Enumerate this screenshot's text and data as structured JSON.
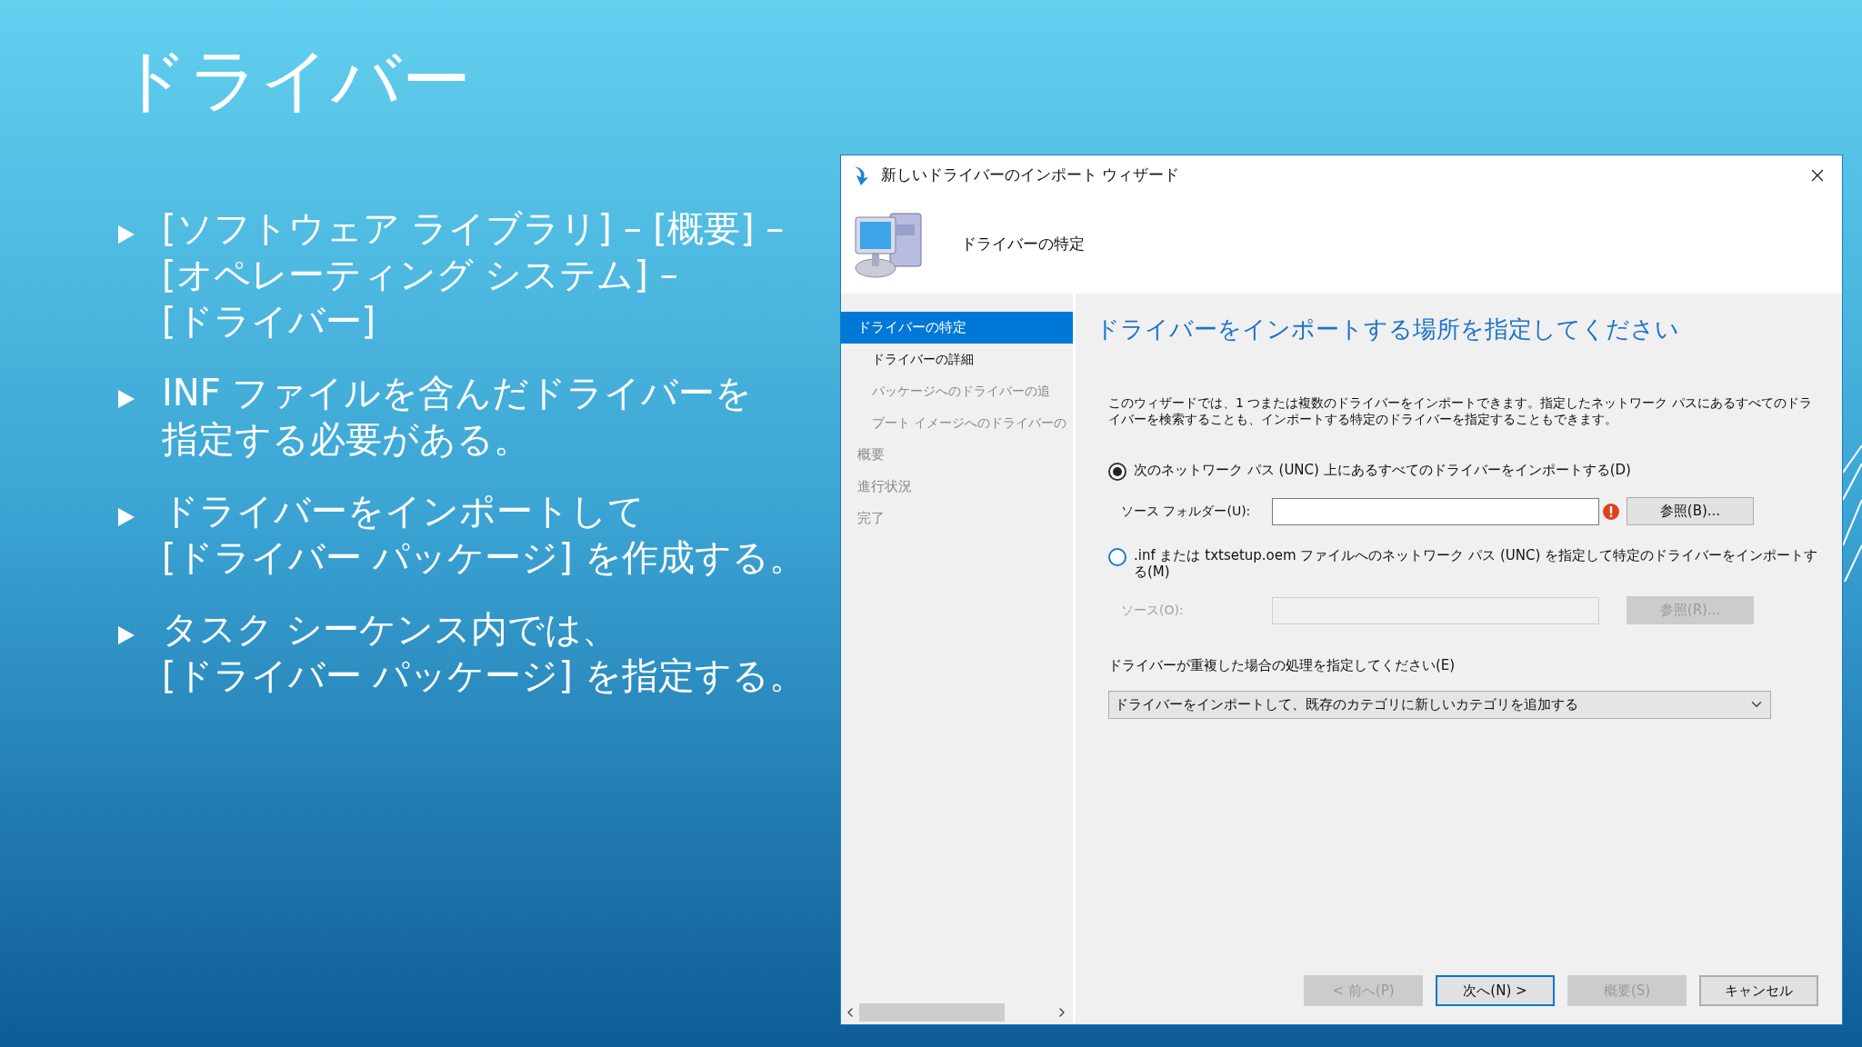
{
  "slide": {
    "title": "ドライバー",
    "bullets": [
      {
        "lines": [
          "[ソフトウェア ライブラリ] – [概要] –",
          "[オペレーティング システム] –",
          "[ドライバー]"
        ]
      },
      {
        "lines": [
          "INF ファイルを含んだドライバーを",
          "指定する必要がある。"
        ]
      },
      {
        "lines": [
          "ドライバーをインポートして",
          "[ドライバー パッケージ] を作成する。"
        ]
      },
      {
        "lines": [
          "タスク シーケンス内では、",
          "[ドライバー パッケージ] を指定する。"
        ]
      }
    ]
  },
  "window": {
    "title": "新しいドライバーのインポート ウィザード",
    "header": "ドライバーの特定"
  },
  "sidebar": {
    "items": [
      {
        "label": "ドライバーの特定",
        "selected": true,
        "disabled": false,
        "children": [
          {
            "label": "ドライバーの詳細",
            "selected": false,
            "disabled": false
          },
          {
            "label": "パッケージへのドライバーの追",
            "selected": false,
            "disabled": true
          },
          {
            "label": "ブート イメージへのドライバーの",
            "selected": false,
            "disabled": true
          }
        ]
      },
      {
        "label": "概要",
        "selected": false,
        "disabled": true
      },
      {
        "label": "進行状況",
        "selected": false,
        "disabled": true
      },
      {
        "label": "完了",
        "selected": false,
        "disabled": true
      }
    ]
  },
  "content": {
    "heading": "ドライバーをインポートする場所を指定してください",
    "description": "このウィザードでは、1 つまたは複数のドライバーをインポートできます。指定したネットワーク パスにあるすべてのドライバーを検索することも、インポートする特定のドライバーを指定することもできます。",
    "options": [
      {
        "label": "次のネットワーク パス (UNC) 上にあるすべてのドライバーをインポートする(D)",
        "selected": true,
        "field": {
          "label": "ソース フォルダー(U):",
          "disabled": false,
          "error": true,
          "button": "参照(B)..."
        }
      },
      {
        "label": ".inf または txtsetup.oem ファイルへのネットワーク パス (UNC) を指定して特定のドライバーをインポートする(M)",
        "selected": false,
        "field": {
          "label": "ソース(O):",
          "disabled": true,
          "error": false,
          "button": "参照(R)..."
        }
      }
    ],
    "duplicate_label": "ドライバーが重複した場合の処理を指定してください(E)",
    "duplicate_value": "ドライバーをインポートして、既存のカテゴリに新しいカテゴリを追加する"
  },
  "buttons": [
    {
      "label": "< 前へ(P)",
      "disabled": true,
      "default": false
    },
    {
      "label": "次へ(N) >",
      "disabled": false,
      "default": true
    },
    {
      "label": "概要(S)",
      "disabled": true,
      "default": false
    },
    {
      "label": "キャンセル",
      "disabled": false,
      "default": false
    }
  ]
}
